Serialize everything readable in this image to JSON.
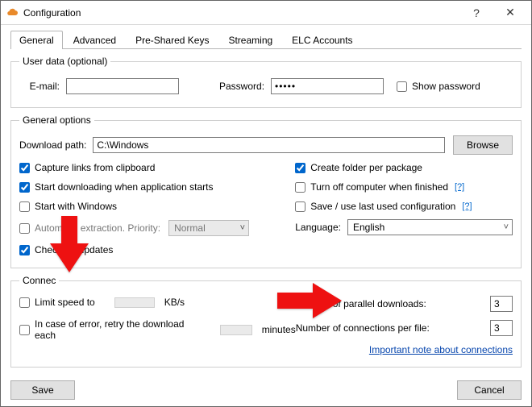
{
  "window": {
    "title": "Configuration",
    "help_glyph": "?",
    "close_glyph": "✕"
  },
  "tabs": [
    "General",
    "Advanced",
    "Pre-Shared Keys",
    "Streaming",
    "ELC Accounts"
  ],
  "active_tab": 0,
  "user_data": {
    "legend": "User data (optional)",
    "email_label": "E-mail:",
    "email_value": "",
    "password_label": "Password:",
    "password_value": "•••••",
    "show_password_label": "Show password",
    "show_password_checked": false
  },
  "general_options": {
    "legend": "General options",
    "download_path_label": "Download path:",
    "download_path_value": "C:\\Windows",
    "browse_label": "Browse",
    "left": [
      {
        "label": "Capture links from clipboard",
        "checked": true
      },
      {
        "label": "Start downloading when application starts",
        "checked": true
      },
      {
        "label": "Start with Windows",
        "checked": false
      },
      {
        "label": "Automatic extraction. Priority:",
        "checked": false,
        "priority_value": "Normal",
        "priority_disabled": true
      },
      {
        "label": "Check for updates",
        "checked": true,
        "truncated_label": "Che          updates"
      }
    ],
    "right": [
      {
        "label": "Create folder per package",
        "checked": true,
        "help": false
      },
      {
        "label": "Turn off computer when finished",
        "checked": false,
        "help": true
      },
      {
        "label": "Save / use last used configuration",
        "checked": false,
        "help": true
      }
    ],
    "language_label": "Language:",
    "language_value": "English",
    "help_glyph": "[?]"
  },
  "connection": {
    "legend": "Connection",
    "truncated_legend": "Connec",
    "limit_speed_label": "Limit speed to",
    "limit_speed_checked": false,
    "limit_speed_value": "",
    "limit_speed_unit": "KB/s",
    "retry_label": "In case of error, retry the download each",
    "retry_checked": false,
    "retry_value": "",
    "retry_unit": "minutes",
    "parallel_label": "Number of parallel downloads:",
    "parallel_value": "3",
    "connections_label": "Number of connections per file:",
    "connections_value": "3",
    "note_link": "Important note about connections"
  },
  "buttons": {
    "save": "Save",
    "cancel": "Cancel"
  },
  "annotations": {
    "arrow_left": "red-arrow-down",
    "arrow_right": "red-arrow-right"
  }
}
